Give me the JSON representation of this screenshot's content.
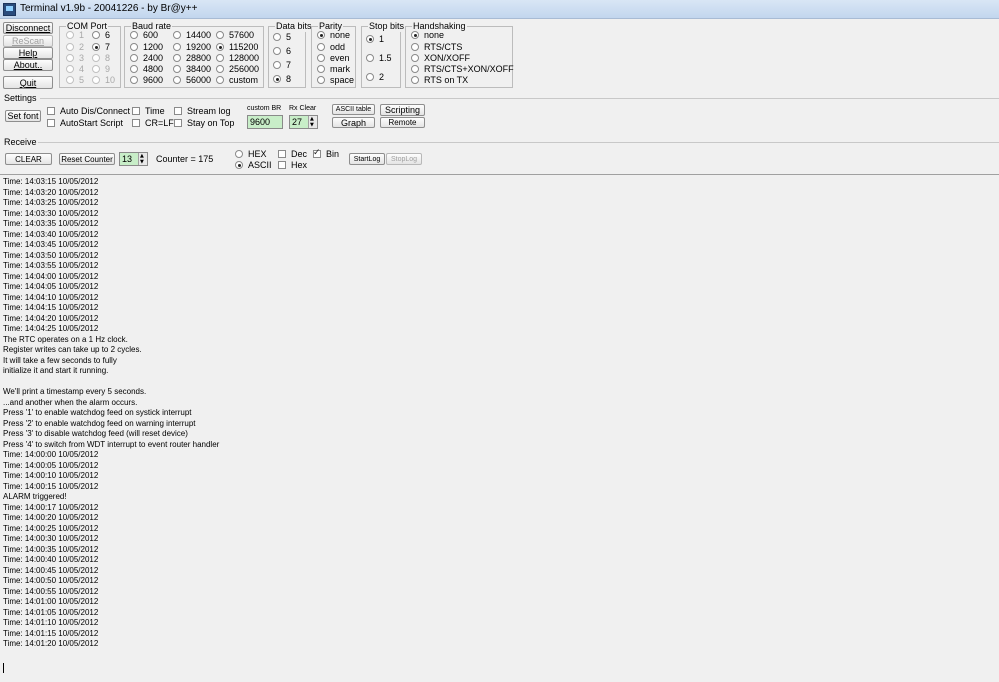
{
  "window": {
    "title": "Terminal v1.9b - 20041226 - by Br@y++"
  },
  "buttons": {
    "disconnect": "Disconnect",
    "rescan": "ReScan",
    "help": "Help",
    "about": "About..",
    "quit": "Quit",
    "set_font": "Set font",
    "ascii_table": "ASCII table",
    "scripting": "Scripting",
    "graph": "Graph",
    "remote": "Remote",
    "clear": "CLEAR",
    "reset_counter": "Reset Counter",
    "start_log": "StartLog",
    "stop_log": "StopLog"
  },
  "com_port": {
    "title": "COM Port",
    "options": [
      "1",
      "2",
      "3",
      "4",
      "5",
      "6",
      "7",
      "8",
      "9",
      "10"
    ],
    "selected": "7"
  },
  "baud_rate": {
    "title": "Baud rate",
    "options": [
      "600",
      "1200",
      "2400",
      "4800",
      "9600",
      "14400",
      "19200",
      "28800",
      "38400",
      "56000",
      "57600",
      "115200",
      "128000",
      "256000",
      "custom"
    ],
    "selected": "115200"
  },
  "data_bits": {
    "title": "Data bits",
    "options": [
      "5",
      "6",
      "7",
      "8"
    ],
    "selected": "8"
  },
  "parity": {
    "title": "Parity",
    "options": [
      "none",
      "odd",
      "even",
      "mark",
      "space"
    ],
    "selected": "none"
  },
  "stop_bits": {
    "title": "Stop bits",
    "options": [
      "1",
      "1.5",
      "2"
    ],
    "selected": "1"
  },
  "handshaking": {
    "title": "Handshaking",
    "options": [
      "none",
      "RTS/CTS",
      "XON/XOFF",
      "RTS/CTS+XON/XOFF",
      "RTS on TX"
    ],
    "selected": "none"
  },
  "settings": {
    "label": "Settings",
    "auto_dis_connect": "Auto Dis/Connect",
    "autostart_script": "AutoStart Script",
    "time": "Time",
    "cr_lf": "CR=LF",
    "stream_log": "Stream log",
    "stay_on_top": "Stay on Top",
    "custom_br_label": "custom BR",
    "custom_br_value": "9600",
    "rx_clear_label": "Rx Clear",
    "rx_clear_value": "27"
  },
  "receive": {
    "label": "Receive",
    "counter_value": "13",
    "counter_text": "Counter = 175",
    "hex": "HEX",
    "ascii": "ASCII",
    "mode_selected": "ASCII",
    "dec": "Dec",
    "hex_check": "Hex",
    "bin": "Bin"
  },
  "terminal_lines": [
    "Time: 14:03:15 10/05/2012",
    "Time: 14:03:20 10/05/2012",
    "Time: 14:03:25 10/05/2012",
    "Time: 14:03:30 10/05/2012",
    "Time: 14:03:35 10/05/2012",
    "Time: 14:03:40 10/05/2012",
    "Time: 14:03:45 10/05/2012",
    "Time: 14:03:50 10/05/2012",
    "Time: 14:03:55 10/05/2012",
    "Time: 14:04:00 10/05/2012",
    "Time: 14:04:05 10/05/2012",
    "Time: 14:04:10 10/05/2012",
    "Time: 14:04:15 10/05/2012",
    "Time: 14:04:20 10/05/2012",
    "Time: 14:04:25 10/05/2012",
    "The RTC operates on a 1 Hz clock.",
    "Register writes can take up to 2 cycles.",
    "It will take a few seconds to fully",
    "initialize it and start it running.",
    "",
    "We'll print a timestamp every 5 seconds.",
    "...and another when the alarm occurs.",
    "Press '1' to enable watchdog feed on systick interrupt",
    "Press '2' to enable watchdog feed on warning interrupt",
    "Press '3' to disable watchdog feed (will reset device)",
    "Press '4' to switch from WDT interrupt to event router handler",
    "Time: 14:00:00 10/05/2012",
    "Time: 14:00:05 10/05/2012",
    "Time: 14:00:10 10/05/2012",
    "Time: 14:00:15 10/05/2012",
    "ALARM triggered!",
    "Time: 14:00:17 10/05/2012",
    "Time: 14:00:20 10/05/2012",
    "Time: 14:00:25 10/05/2012",
    "Time: 14:00:30 10/05/2012",
    "Time: 14:00:35 10/05/2012",
    "Time: 14:00:40 10/05/2012",
    "Time: 14:00:45 10/05/2012",
    "Time: 14:00:50 10/05/2012",
    "Time: 14:00:55 10/05/2012",
    "Time: 14:01:00 10/05/2012",
    "Time: 14:01:05 10/05/2012",
    "Time: 14:01:10 10/05/2012",
    "Time: 14:01:15 10/05/2012",
    "Time: 14:01:20 10/05/2012"
  ]
}
